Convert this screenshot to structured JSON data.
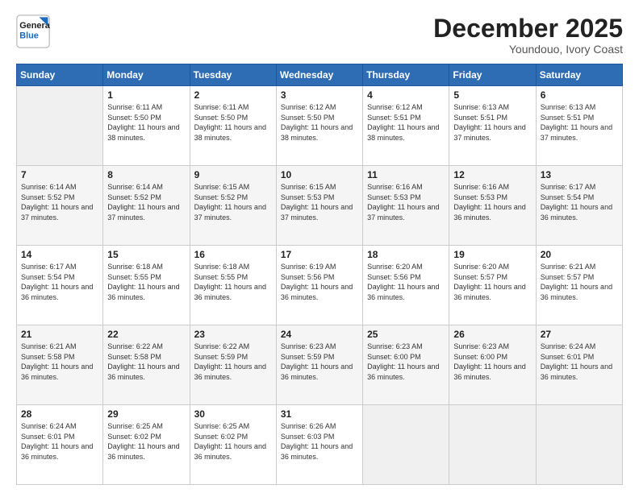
{
  "header": {
    "logo_line1": "General",
    "logo_line2": "Blue",
    "month": "December 2025",
    "location": "Youndouo, Ivory Coast"
  },
  "weekdays": [
    "Sunday",
    "Monday",
    "Tuesday",
    "Wednesday",
    "Thursday",
    "Friday",
    "Saturday"
  ],
  "weeks": [
    [
      {
        "day": "",
        "empty": true
      },
      {
        "day": "1",
        "sunrise": "6:11 AM",
        "sunset": "5:50 PM",
        "daylight": "11 hours and 38 minutes."
      },
      {
        "day": "2",
        "sunrise": "6:11 AM",
        "sunset": "5:50 PM",
        "daylight": "11 hours and 38 minutes."
      },
      {
        "day": "3",
        "sunrise": "6:12 AM",
        "sunset": "5:50 PM",
        "daylight": "11 hours and 38 minutes."
      },
      {
        "day": "4",
        "sunrise": "6:12 AM",
        "sunset": "5:51 PM",
        "daylight": "11 hours and 38 minutes."
      },
      {
        "day": "5",
        "sunrise": "6:13 AM",
        "sunset": "5:51 PM",
        "daylight": "11 hours and 37 minutes."
      },
      {
        "day": "6",
        "sunrise": "6:13 AM",
        "sunset": "5:51 PM",
        "daylight": "11 hours and 37 minutes."
      }
    ],
    [
      {
        "day": "7",
        "sunrise": "6:14 AM",
        "sunset": "5:52 PM",
        "daylight": "11 hours and 37 minutes."
      },
      {
        "day": "8",
        "sunrise": "6:14 AM",
        "sunset": "5:52 PM",
        "daylight": "11 hours and 37 minutes."
      },
      {
        "day": "9",
        "sunrise": "6:15 AM",
        "sunset": "5:52 PM",
        "daylight": "11 hours and 37 minutes."
      },
      {
        "day": "10",
        "sunrise": "6:15 AM",
        "sunset": "5:53 PM",
        "daylight": "11 hours and 37 minutes."
      },
      {
        "day": "11",
        "sunrise": "6:16 AM",
        "sunset": "5:53 PM",
        "daylight": "11 hours and 37 minutes."
      },
      {
        "day": "12",
        "sunrise": "6:16 AM",
        "sunset": "5:53 PM",
        "daylight": "11 hours and 36 minutes."
      },
      {
        "day": "13",
        "sunrise": "6:17 AM",
        "sunset": "5:54 PM",
        "daylight": "11 hours and 36 minutes."
      }
    ],
    [
      {
        "day": "14",
        "sunrise": "6:17 AM",
        "sunset": "5:54 PM",
        "daylight": "11 hours and 36 minutes."
      },
      {
        "day": "15",
        "sunrise": "6:18 AM",
        "sunset": "5:55 PM",
        "daylight": "11 hours and 36 minutes."
      },
      {
        "day": "16",
        "sunrise": "6:18 AM",
        "sunset": "5:55 PM",
        "daylight": "11 hours and 36 minutes."
      },
      {
        "day": "17",
        "sunrise": "6:19 AM",
        "sunset": "5:56 PM",
        "daylight": "11 hours and 36 minutes."
      },
      {
        "day": "18",
        "sunrise": "6:20 AM",
        "sunset": "5:56 PM",
        "daylight": "11 hours and 36 minutes."
      },
      {
        "day": "19",
        "sunrise": "6:20 AM",
        "sunset": "5:57 PM",
        "daylight": "11 hours and 36 minutes."
      },
      {
        "day": "20",
        "sunrise": "6:21 AM",
        "sunset": "5:57 PM",
        "daylight": "11 hours and 36 minutes."
      }
    ],
    [
      {
        "day": "21",
        "sunrise": "6:21 AM",
        "sunset": "5:58 PM",
        "daylight": "11 hours and 36 minutes."
      },
      {
        "day": "22",
        "sunrise": "6:22 AM",
        "sunset": "5:58 PM",
        "daylight": "11 hours and 36 minutes."
      },
      {
        "day": "23",
        "sunrise": "6:22 AM",
        "sunset": "5:59 PM",
        "daylight": "11 hours and 36 minutes."
      },
      {
        "day": "24",
        "sunrise": "6:23 AM",
        "sunset": "5:59 PM",
        "daylight": "11 hours and 36 minutes."
      },
      {
        "day": "25",
        "sunrise": "6:23 AM",
        "sunset": "6:00 PM",
        "daylight": "11 hours and 36 minutes."
      },
      {
        "day": "26",
        "sunrise": "6:23 AM",
        "sunset": "6:00 PM",
        "daylight": "11 hours and 36 minutes."
      },
      {
        "day": "27",
        "sunrise": "6:24 AM",
        "sunset": "6:01 PM",
        "daylight": "11 hours and 36 minutes."
      }
    ],
    [
      {
        "day": "28",
        "sunrise": "6:24 AM",
        "sunset": "6:01 PM",
        "daylight": "11 hours and 36 minutes."
      },
      {
        "day": "29",
        "sunrise": "6:25 AM",
        "sunset": "6:02 PM",
        "daylight": "11 hours and 36 minutes."
      },
      {
        "day": "30",
        "sunrise": "6:25 AM",
        "sunset": "6:02 PM",
        "daylight": "11 hours and 36 minutes."
      },
      {
        "day": "31",
        "sunrise": "6:26 AM",
        "sunset": "6:03 PM",
        "daylight": "11 hours and 36 minutes."
      },
      {
        "day": "",
        "empty": true
      },
      {
        "day": "",
        "empty": true
      },
      {
        "day": "",
        "empty": true
      }
    ]
  ]
}
